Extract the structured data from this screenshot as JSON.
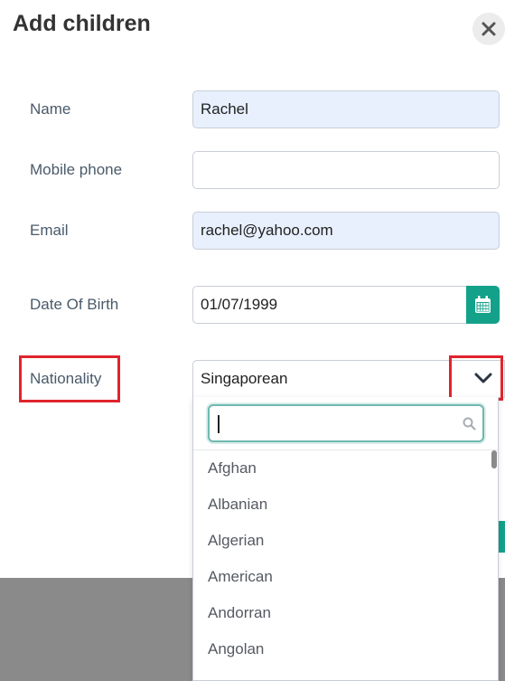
{
  "dialog": {
    "title": "Add children"
  },
  "form": {
    "name_label": "Name",
    "name_value": "Rachel",
    "mobile_label": "Mobile phone",
    "mobile_value": "",
    "email_label": "Email",
    "email_value": "rachel@yahoo.com",
    "dob_label": "Date Of Birth",
    "dob_value": "01/07/1999",
    "nationality_label": "Nationality",
    "nationality_value": "Singaporean"
  },
  "dropdown": {
    "search_value": "",
    "options": [
      "Afghan",
      "Albanian",
      "Algerian",
      "American",
      "Andorran",
      "Angolan"
    ]
  },
  "icons": {
    "close": "close-icon",
    "calendar": "calendar-icon",
    "chevron": "chevron-down-icon",
    "search": "search-icon"
  },
  "colors": {
    "accent": "#13a18a",
    "highlight": "#e0242e",
    "autofill": "#e8f0fe",
    "backdrop": "#8a8a8a"
  }
}
